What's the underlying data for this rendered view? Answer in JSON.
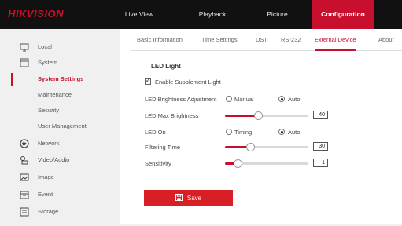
{
  "brand": "HIKVISION",
  "nav": [
    "Live View",
    "Playback",
    "Picture",
    "Configuration"
  ],
  "sidebar": {
    "items": [
      {
        "label": "Local",
        "icon": "monitor-icon"
      },
      {
        "label": "System",
        "icon": "system-icon"
      },
      {
        "label": "System Settings"
      },
      {
        "label": "Maintenance"
      },
      {
        "label": "Security"
      },
      {
        "label": "User Management"
      },
      {
        "label": "Network",
        "icon": "globe-icon"
      },
      {
        "label": "Video/Audio",
        "icon": "video-audio-icon"
      },
      {
        "label": "Image",
        "icon": "image-icon"
      },
      {
        "label": "Event",
        "icon": "calendar-icon"
      },
      {
        "label": "Storage",
        "icon": "storage-icon"
      }
    ]
  },
  "tabs": [
    "Basic Information",
    "Time Settings",
    "DST",
    "RS-232",
    "External Device",
    "About"
  ],
  "section": {
    "title": "LED Light"
  },
  "form": {
    "enable_label": "Enable Supplement Light",
    "enabled": true,
    "brightness_adj_label": "LED Brightness Adjustment",
    "brightness_adj_options": [
      "Manual",
      "Auto"
    ],
    "brightness_adj_selected": "Auto",
    "max_brightness_label": "LED Max Brightness",
    "max_brightness_value": "40",
    "max_brightness_fraction": 0.4,
    "led_on_label": "LED On",
    "led_on_options": [
      "Timing",
      "Auto"
    ],
    "led_on_selected": "Auto",
    "filtering_time_label": "Filtering Time",
    "filtering_time_value": "30",
    "filtering_time_fraction": 0.3,
    "sensitivity_label": "Sensitivity",
    "sensitivity_value": "1",
    "sensitivity_fraction": 0.15
  },
  "save_label": "Save",
  "colors": {
    "accent": "#c8102e",
    "topbar": "#111111",
    "sidebar_bg": "#f0f0f0"
  }
}
